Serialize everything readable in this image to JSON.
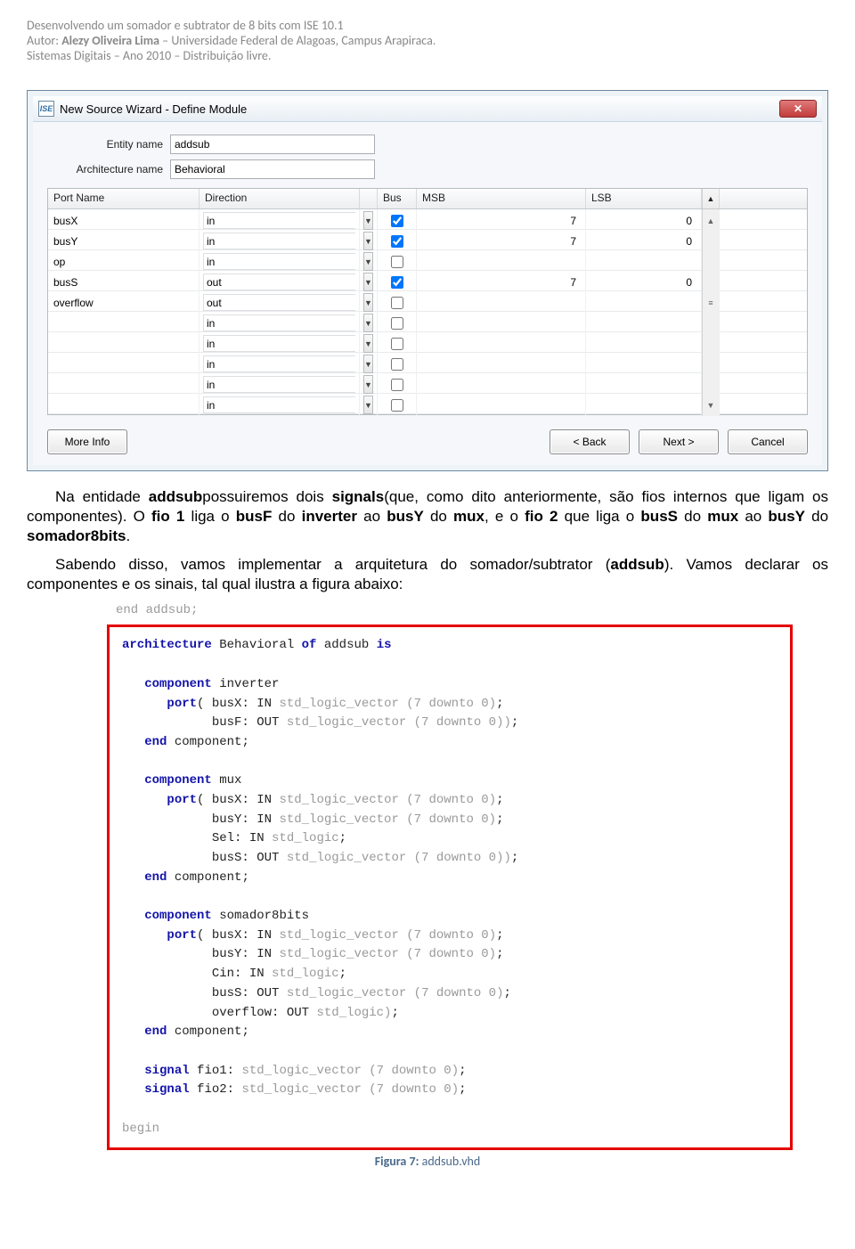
{
  "header": {
    "line1": "Desenvolvendo um somador e subtrator de 8 bits com ISE 10.1",
    "author_prefix": "Autor: ",
    "author_name": "Alezy Oliveira Lima",
    "author_suffix": " – Universidade Federal de Alagoas, Campus Arapiraca.",
    "line3": "Sistemas Digitais – Ano 2010 – Distribuição livre."
  },
  "dialog": {
    "app_icon_text": "ISE",
    "title": "New Source Wizard - Define Module",
    "close_glyph": "✕",
    "entity_label": "Entity name",
    "entity_value": "addsub",
    "arch_label": "Architecture name",
    "arch_value": "Behavioral",
    "columns": {
      "port": "Port Name",
      "direction": "Direction",
      "bus": "Bus",
      "msb": "MSB",
      "lsb": "LSB"
    },
    "rows": [
      {
        "port": "busX",
        "dir": "in",
        "bus": true,
        "msb": "7",
        "lsb": "0",
        "scroll": "▲"
      },
      {
        "port": "busY",
        "dir": "in",
        "bus": true,
        "msb": "7",
        "lsb": "0",
        "scroll": ""
      },
      {
        "port": "op",
        "dir": "in",
        "bus": false,
        "msb": "",
        "lsb": "",
        "scroll": ""
      },
      {
        "port": "busS",
        "dir": "out",
        "bus": true,
        "msb": "7",
        "lsb": "0",
        "scroll": ""
      },
      {
        "port": "overflow",
        "dir": "out",
        "bus": false,
        "msb": "",
        "lsb": "",
        "scroll": "≡"
      },
      {
        "port": "",
        "dir": "in",
        "bus": false,
        "msb": "",
        "lsb": "",
        "scroll": ""
      },
      {
        "port": "",
        "dir": "in",
        "bus": false,
        "msb": "",
        "lsb": "",
        "scroll": ""
      },
      {
        "port": "",
        "dir": "in",
        "bus": false,
        "msb": "",
        "lsb": "",
        "scroll": ""
      },
      {
        "port": "",
        "dir": "in",
        "bus": false,
        "msb": "",
        "lsb": "",
        "scroll": ""
      },
      {
        "port": "",
        "dir": "in",
        "bus": false,
        "msb": "",
        "lsb": "",
        "scroll": "▼"
      }
    ],
    "buttons": {
      "more": "More Info",
      "back": "< Back",
      "next": "Next >",
      "cancel": "Cancel"
    }
  },
  "paragraphs": {
    "p1_frag1": "Na entidade ",
    "p1_b1": "addsub",
    "p1_frag2": "possuiremos dois ",
    "p1_b2": "signals",
    "p1_frag3": "(que, como dito anteriormente, são fios internos que ligam os componentes). O ",
    "p1_b3": "fio 1",
    "p1_frag4": " liga o ",
    "p1_b4": "busF",
    "p1_frag5": " do ",
    "p1_b5": "inverter",
    "p1_frag6": " ao ",
    "p1_b6": "busY",
    "p1_frag7": " do ",
    "p1_b7": "mux",
    "p1_frag8": ", e o ",
    "p1_b8": "fio 2",
    "p1_frag9": " que liga o ",
    "p1_b9": "busS",
    "p1_frag10": " do ",
    "p1_b10": "mux",
    "p1_frag11": " ao ",
    "p1_b11": "busY",
    "p1_frag12": " do ",
    "p1_b12": "somador8bits",
    "p1_frag13": ".",
    "p2_frag1": "Sabendo disso, vamos implementar a arquitetura do somador/subtrator (",
    "p2_b1": "addsub",
    "p2_frag2": "). Vamos declarar os componentes e os sinais, tal qual ilustra a figura abaixo:"
  },
  "code_pre": "end addsub;",
  "code": {
    "l1a": "architecture",
    "l1b": " Behavioral ",
    "l1c": "of",
    "l1d": " addsub ",
    "l1e": "is",
    "c_kw_component": "component",
    "c_kw_port": "port",
    "c_kw_end": "end",
    "c_kw_signal": "signal",
    "c_inverter": " inverter",
    "c_inv_p1": "( busX: IN ",
    "c_inv_t1": "std_logic_vector (7 downto 0)",
    "c_sc": ";",
    "c_inv_p2": "  busF: OUT ",
    "c_inv_t2": "std_logic_vector (7 downto 0))",
    "c_sc2": ";",
    "c_endcomp": " component;",
    "c_mux": " mux",
    "c_mux_p1": "( busX: IN ",
    "c_mux_t1": "std_logic_vector (7 downto 0)",
    "c_mux_p2": "  busY: IN ",
    "c_mux_t2": "std_logic_vector (7 downto 0)",
    "c_mux_p3": "  Sel: IN ",
    "c_mux_t3": "std_logic",
    "c_mux_p4": "  busS: OUT ",
    "c_mux_t4": "std_logic_vector (7 downto 0))",
    "c_som": " somador8bits",
    "c_som_p1": "( busX: IN ",
    "c_som_t1": "std_logic_vector (7 downto 0)",
    "c_som_p2": "  busY: IN ",
    "c_som_t2": "std_logic_vector (7 downto 0)",
    "c_som_p3": "  Cin: IN ",
    "c_som_t3": "std_logic",
    "c_som_p4": "  busS: OUT ",
    "c_som_t4": "std_logic_vector (7 downto 0)",
    "c_som_p5": "  overflow: OUT ",
    "c_som_t5": "std_logic)",
    "sig1a": " fio1: ",
    "sig1b": "std_logic_vector (7 downto 0)",
    "sig2a": " fio2: ",
    "sig2b": "std_logic_vector (7 downto 0)",
    "begin": "begin"
  },
  "figure": {
    "label": "Figura 7:",
    "name": " addsub.vhd"
  }
}
